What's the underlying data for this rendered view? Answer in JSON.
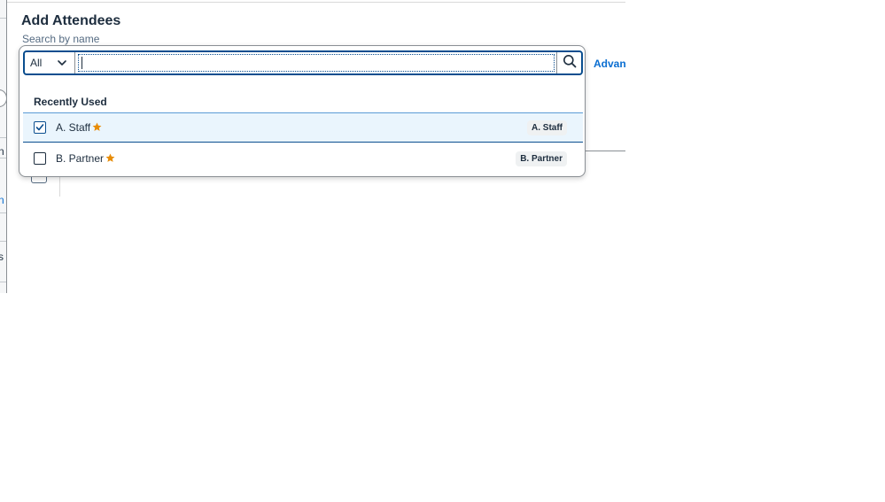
{
  "dialog": {
    "title": "Add Attendees",
    "subtitle": "Search by name",
    "advanced_link": "Advanced"
  },
  "search": {
    "scope_value": "All",
    "query": "",
    "placeholder": "",
    "search_icon": "magnifier-icon",
    "scope_icon": "chevron-down-icon"
  },
  "suggestions": {
    "section_title": "Recently Used",
    "items": [
      {
        "name": "A. Staff",
        "token": "A. Staff",
        "checked": true,
        "favorite": true
      },
      {
        "name": "B. Partner",
        "token": "B. Partner",
        "checked": false,
        "favorite": true
      }
    ]
  },
  "colors": {
    "accent": "#0a6ed1",
    "focus_border": "#0a4e8f",
    "selected_row": "#eaf5fd",
    "star": "#e78c07"
  }
}
